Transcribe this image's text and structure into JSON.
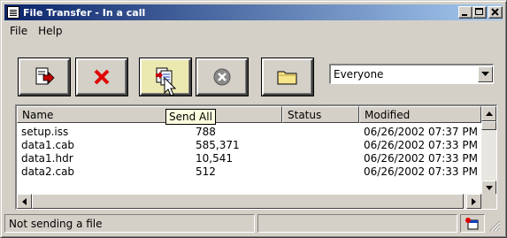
{
  "window": {
    "title": "File Transfer - In a call"
  },
  "menu": [
    "File",
    "Help"
  ],
  "toolbar": {
    "buttons": [
      {
        "name": "send-file-button",
        "icon": "send-file-icon"
      },
      {
        "name": "delete-button",
        "icon": "delete-x-icon"
      },
      {
        "name": "send-all-button",
        "icon": "send-all-icon"
      },
      {
        "name": "stop-button",
        "icon": "stop-icon"
      },
      {
        "name": "open-folder-button",
        "icon": "folder-icon"
      }
    ],
    "recipient_select": "Everyone"
  },
  "list": {
    "columns": [
      "Name",
      "Status",
      "Modified"
    ],
    "rows": [
      {
        "name": "setup.iss",
        "size": "788",
        "status": "",
        "modified": "06/26/2002 07:37 PM"
      },
      {
        "name": "data1.cab",
        "size": "585,371",
        "status": "",
        "modified": "06/26/2002 07:33 PM"
      },
      {
        "name": "data1.hdr",
        "size": "10,541",
        "status": "",
        "modified": "06/26/2002 07:33 PM"
      },
      {
        "name": "data2.cab",
        "size": "512",
        "status": "",
        "modified": "06/26/2002 07:33 PM"
      }
    ]
  },
  "tooltip": "Send All",
  "status": {
    "text": "Not sending a file",
    "panel2": ""
  },
  "colors": {
    "titlebar_start": "#0a246a",
    "titlebar_end": "#a6caf0",
    "face": "#d4d0c8"
  }
}
